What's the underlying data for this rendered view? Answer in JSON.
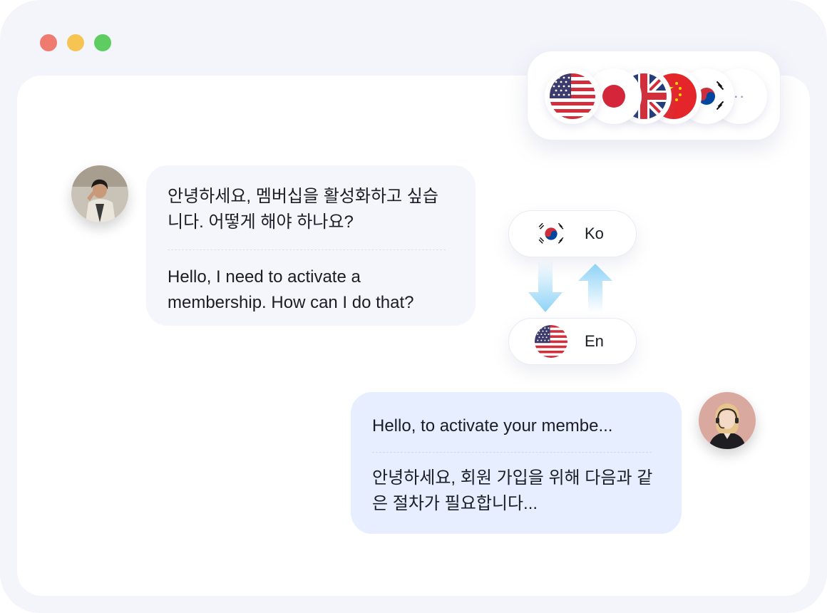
{
  "window": {
    "controls": [
      "close",
      "minimize",
      "maximize"
    ]
  },
  "language_picker": {
    "flags": [
      "us-flag-icon",
      "japan-flag-icon",
      "uk-flag-icon",
      "china-flag-icon",
      "korea-flag-icon"
    ],
    "more_label": "··"
  },
  "chat": {
    "user_message": {
      "original": "안녕하세요, 멤버십을 활성화하고 싶습니다. 어떻게 해야 하나요?",
      "translation": "Hello, I need to activate a membership. How can I do that?"
    },
    "agent_message": {
      "original": "Hello, to activate your membe...",
      "translation": "안녕하세요, 회원 가입을 위해 다음과 같은 절차가 필요합니다..."
    }
  },
  "translation": {
    "source_code": "Ko",
    "target_code": "En"
  },
  "colors": {
    "frame": "#f4f5fb",
    "user_bubble": "#f5f6fc",
    "agent_bubble": "#e6eeff",
    "arrow": "#8fd3f7"
  }
}
